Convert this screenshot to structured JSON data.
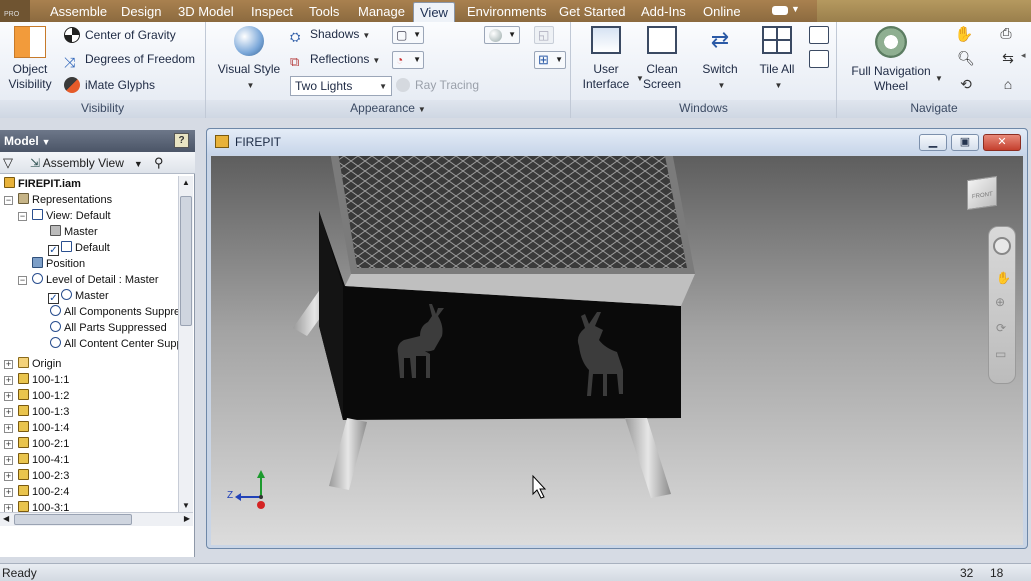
{
  "menu": {
    "tabs": [
      "Assemble",
      "Design",
      "3D Model",
      "Inspect",
      "Tools",
      "Manage",
      "View",
      "Environments",
      "Get Started",
      "Add-Ins",
      "Online"
    ],
    "active_tab": "View",
    "logo_text": "PRO"
  },
  "ribbon": {
    "visibility": {
      "title": "Visibility",
      "object_visibility_line1": "Object",
      "object_visibility_line2": "Visibility",
      "center_of_gravity": "Center of Gravity",
      "degrees_of_freedom": "Degrees of Freedom",
      "imate_glyphs": "iMate Glyphs"
    },
    "appearance": {
      "title": "Appearance",
      "visual_style": "Visual Style",
      "shadows": "Shadows",
      "reflections": "Reflections",
      "lighting_value": "Two Lights",
      "ray_tracing": "Ray Tracing"
    },
    "windows": {
      "title": "Windows",
      "user_interface_line1": "User",
      "user_interface_line2": "Interface",
      "clean_screen_line1": "Clean",
      "clean_screen_line2": "Screen",
      "switch": "Switch",
      "tile_all": "Tile All"
    },
    "navigate": {
      "title": "Navigate",
      "full_nav_line1": "Full Navigation",
      "full_nav_line2": "Wheel"
    }
  },
  "browser": {
    "title": "Model",
    "filter_label": "Assembly View",
    "tree": [
      {
        "label": "FIREPIT.iam",
        "bold": true
      },
      {
        "label": "Representations"
      },
      {
        "label": "View: Default"
      },
      {
        "label": "Master"
      },
      {
        "label": "Default"
      },
      {
        "label": "Position"
      },
      {
        "label": "Level of Detail : Master"
      },
      {
        "label": "Master"
      },
      {
        "label": "All Components Suppres"
      },
      {
        "label": "All Parts Suppressed"
      },
      {
        "label": "All Content Center Supp"
      },
      {
        "label": "Origin"
      },
      {
        "label": "100-1:1"
      },
      {
        "label": "100-1:2"
      },
      {
        "label": "100-1:3"
      },
      {
        "label": "100-1:4"
      },
      {
        "label": "100-2:1"
      },
      {
        "label": "100-4:1"
      },
      {
        "label": "100-2:3"
      },
      {
        "label": "100-2:4"
      },
      {
        "label": "100-3:1"
      }
    ]
  },
  "document": {
    "title": "FIREPIT",
    "viewcube_label": "FRONT",
    "triad_z": "Z"
  },
  "status": {
    "text": "Ready",
    "count1": "32",
    "count2": "18"
  },
  "colors": {
    "menu_bg": "#a9814f",
    "ribbon_bg": "#eef2f8",
    "browser_header": "#5a6477",
    "viewport_top": "#5e5e5e",
    "viewport_bottom": "#dcdcdc"
  }
}
